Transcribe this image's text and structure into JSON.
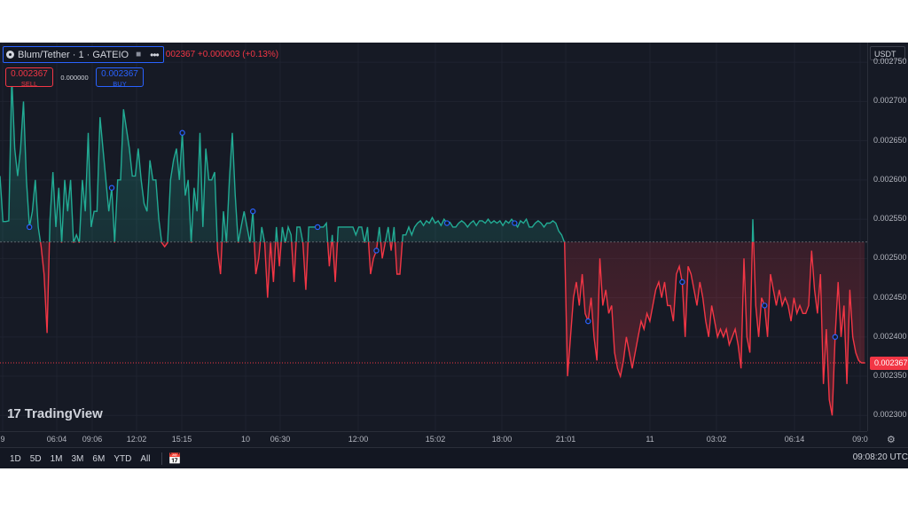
{
  "symbol": {
    "name": "Blum/Tether · 1 · GATEIO",
    "logo_icon": "blum-logo-icon",
    "compare_icon": "compare-icon",
    "more_icon": "more-dots-icon",
    "ohlc_text": "002367 +0.000003 (+0.13%)"
  },
  "trade": {
    "sell_price": "0.002367",
    "sell_label": "SELL",
    "spread": "0.000000",
    "buy_price": "0.002367",
    "buy_label": "BUY"
  },
  "watermark": {
    "brand": "TradingView",
    "icon": "tradingview-logo-icon"
  },
  "price_axis": {
    "unit": "USDT",
    "ticks": [
      "0.002750",
      "0.002700",
      "0.002650",
      "0.002600",
      "0.002550",
      "0.002500",
      "0.002450",
      "0.002400",
      "0.002350",
      "0.002300"
    ],
    "last_price": "0.002367"
  },
  "time_axis": {
    "labels": [
      "9",
      "06:04",
      "09:06",
      "12:02",
      "15:15",
      "10",
      "06:30",
      "12:00",
      "15:02",
      "18:00",
      "21:01",
      "11",
      "03:02",
      "06:14",
      "09:0"
    ]
  },
  "bottom_bar": {
    "ranges": [
      "1D",
      "5D",
      "1M",
      "3M",
      "6M",
      "YTD",
      "All"
    ],
    "calendar_icon": "calendar-range-icon",
    "clock": "09:08:20 UTC"
  },
  "colors": {
    "up": "#22ab94",
    "down": "#f23645",
    "background": "#161a25",
    "accent": "#2962ff"
  },
  "chart_data": {
    "type": "line",
    "baseline": 0.002521,
    "last_price": 0.002367,
    "y_range": [
      0.00228,
      0.002775
    ],
    "x_labels": [
      "9",
      "06:04",
      "09:06",
      "12:02",
      "15:15",
      "10",
      "06:30",
      "12:00",
      "15:02",
      "18:00",
      "21:01",
      "11",
      "03:02",
      "06:14",
      "09:0"
    ],
    "values": [
      0.002605,
      0.002547,
      0.002547,
      0.002548,
      0.00273,
      0.00264,
      0.002605,
      0.00264,
      0.0027,
      0.0026,
      0.00254,
      0.00256,
      0.0026,
      0.00254,
      0.002515,
      0.00248,
      0.002405,
      0.00255,
      0.00261,
      0.00254,
      0.00259,
      0.00252,
      0.0026,
      0.00256,
      0.0026,
      0.00252,
      0.00253,
      0.00252,
      0.0026,
      0.00256,
      0.00266,
      0.00254,
      0.00256,
      0.00256,
      0.00268,
      0.00264,
      0.0026,
      0.00256,
      0.00259,
      0.00252,
      0.0026,
      0.0026,
      0.00269,
      0.002665,
      0.00264,
      0.002605,
      0.002605,
      0.00264,
      0.0026,
      0.00257,
      0.00256,
      0.002625,
      0.0026,
      0.0026,
      0.00255,
      0.00252,
      0.002515,
      0.00252,
      0.0026,
      0.002625,
      0.00264,
      0.0026,
      0.00266,
      0.00258,
      0.0026,
      0.00252,
      0.00259,
      0.00256,
      0.00266,
      0.00254,
      0.00264,
      0.0026,
      0.0026,
      0.00261,
      0.00251,
      0.00248,
      0.00256,
      0.00252,
      0.0026,
      0.00266,
      0.00258,
      0.00252,
      0.00254,
      0.00256,
      0.00254,
      0.00252,
      0.00256,
      0.00248,
      0.0025,
      0.00254,
      0.00252,
      0.00245,
      0.00252,
      0.00247,
      0.00254,
      0.00249,
      0.00254,
      0.00252,
      0.00254,
      0.00253,
      0.00247,
      0.00254,
      0.00254,
      0.00252,
      0.00246,
      0.00254,
      0.00254,
      0.00254,
      0.00254,
      0.00254,
      0.00254,
      0.002545,
      0.00249,
      0.00253,
      0.00247,
      0.00254,
      0.00254,
      0.00254,
      0.00254,
      0.00254,
      0.00254,
      0.00253,
      0.00254,
      0.00254,
      0.00252,
      0.00254,
      0.00248,
      0.0025,
      0.00251,
      0.00254,
      0.0025,
      0.00252,
      0.00254,
      0.00251,
      0.00254,
      0.00248,
      0.00248,
      0.00253,
      0.00253,
      0.00254,
      0.00253,
      0.00254,
      0.002545,
      0.002548,
      0.002542,
      0.002548,
      0.002545,
      0.002552,
      0.002545,
      0.002548,
      0.002542,
      0.00255,
      0.002545,
      0.002546,
      0.00254,
      0.00254,
      0.002545,
      0.002548,
      0.002545,
      0.00254,
      0.002545,
      0.002548,
      0.002542,
      0.002548,
      0.002548,
      0.002545,
      0.00255,
      0.002545,
      0.002548,
      0.002545,
      0.002548,
      0.002542,
      0.002548,
      0.002545,
      0.00255,
      0.002545,
      0.00254,
      0.002548,
      0.002545,
      0.00255,
      0.00254,
      0.00254,
      0.002545,
      0.002548,
      0.002545,
      0.00254,
      0.002545,
      0.002545,
      0.002548,
      0.002545,
      0.002535,
      0.00253,
      0.00252,
      0.00235,
      0.0024,
      0.00245,
      0.00247,
      0.00244,
      0.00248,
      0.00243,
      0.00242,
      0.00245,
      0.0024,
      0.00237,
      0.0025,
      0.00244,
      0.00246,
      0.00243,
      0.00244,
      0.00238,
      0.00236,
      0.00235,
      0.00237,
      0.0024,
      0.00238,
      0.00236,
      0.00238,
      0.0024,
      0.00242,
      0.00241,
      0.00243,
      0.00242,
      0.00244,
      0.00246,
      0.00247,
      0.00245,
      0.00247,
      0.00244,
      0.00244,
      0.00242,
      0.00248,
      0.00249,
      0.00247,
      0.0024,
      0.00249,
      0.00248,
      0.00246,
      0.00244,
      0.00247,
      0.00245,
      0.00242,
      0.0024,
      0.00244,
      0.00242,
      0.0024,
      0.00241,
      0.0024,
      0.00241,
      0.00239,
      0.0024,
      0.00241,
      0.00239,
      0.00236,
      0.0025,
      0.0024,
      0.00238,
      0.00255,
      0.00244,
      0.0024,
      0.00245,
      0.00244,
      0.0024,
      0.00248,
      0.00246,
      0.00244,
      0.00246,
      0.00244,
      0.00245,
      0.00244,
      0.00242,
      0.00245,
      0.00243,
      0.00244,
      0.00243,
      0.00243,
      0.00244,
      0.00251,
      0.00246,
      0.00243,
      0.00248,
      0.00234,
      0.00241,
      0.00232,
      0.0023,
      0.0024,
      0.00247,
      0.0024,
      0.00244,
      0.00234,
      0.00246,
      0.0024,
      0.00238,
      0.00237,
      0.002367,
      0.002367
    ]
  }
}
